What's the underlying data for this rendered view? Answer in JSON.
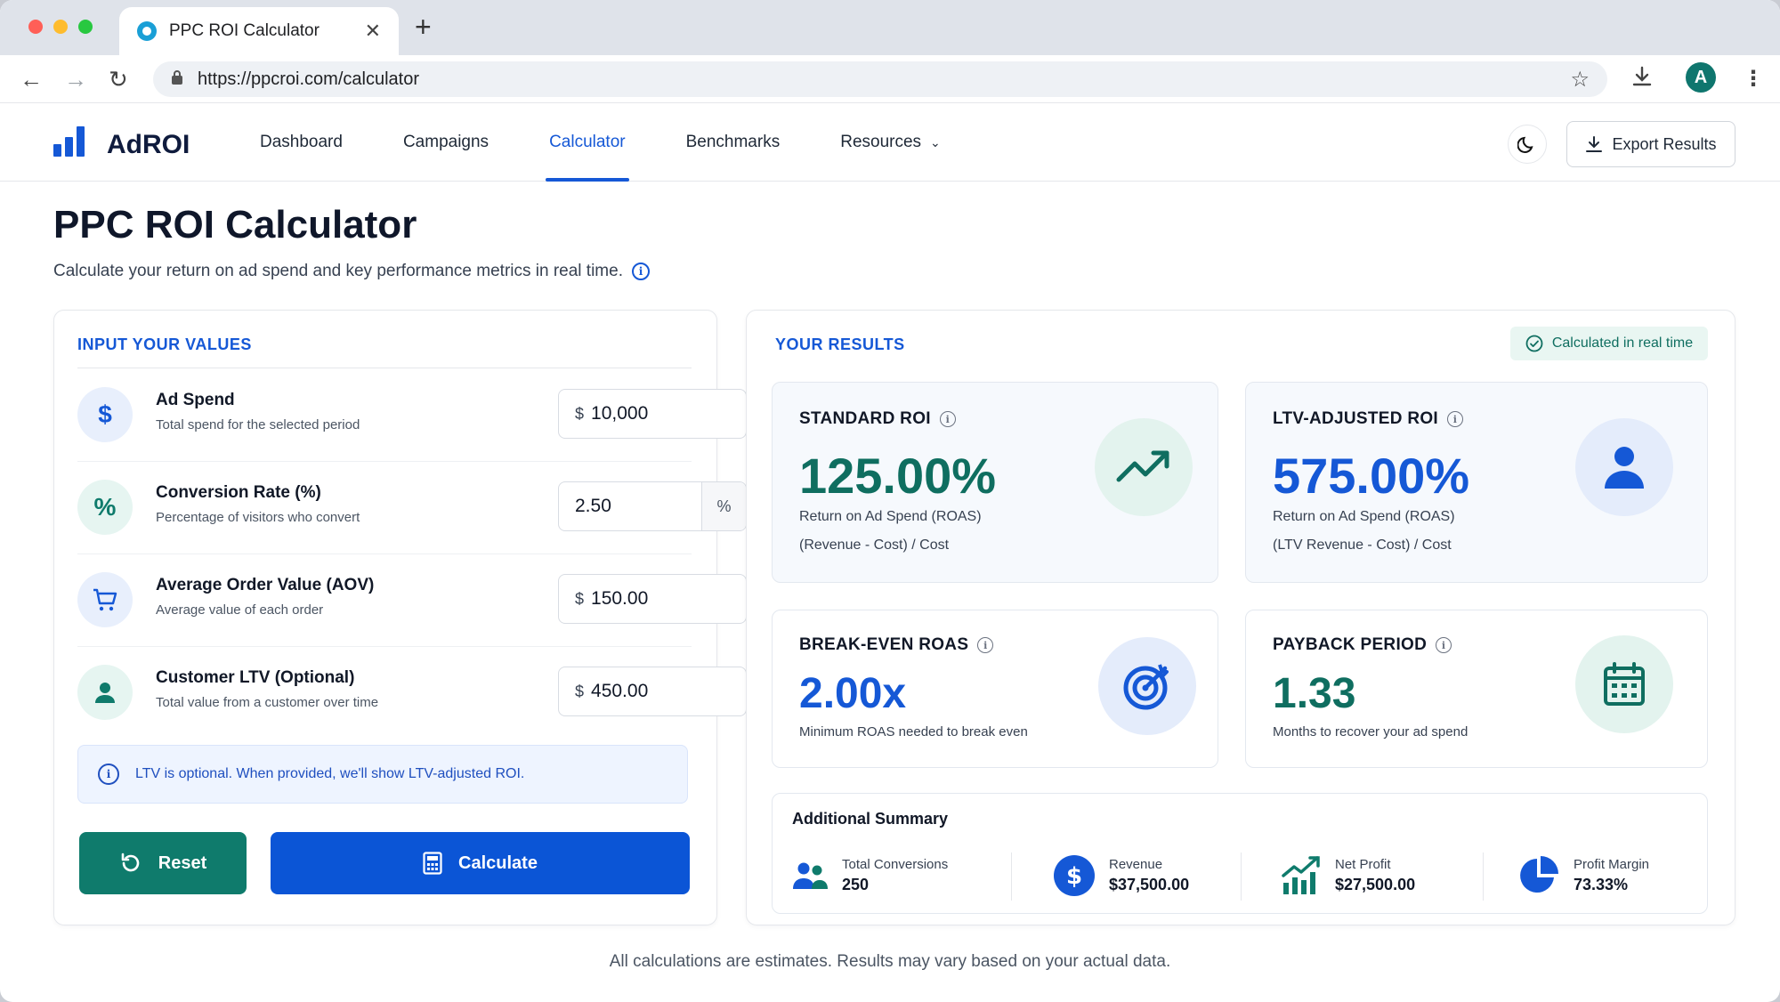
{
  "browser": {
    "tab_title": "PPC ROI Calculator",
    "tab_close": "✕",
    "new_tab": "+",
    "url": "https://ppcroi.com/calculator",
    "profile_initial": "A"
  },
  "header": {
    "logo_text": "AdROI",
    "nav": [
      "Dashboard",
      "Campaigns",
      "Calculator",
      "Benchmarks",
      "Resources"
    ],
    "active_nav": "Calculator",
    "export_label": "Export Results"
  },
  "page": {
    "title": "PPC ROI Calculator",
    "subtitle": "Calculate your return on ad spend and key performance metrics in real time."
  },
  "inputs": {
    "section_title": "INPUT YOUR VALUES",
    "ad_spend": {
      "label": "Ad Spend",
      "hint": "Total spend for the selected period",
      "currency": "$",
      "value": "10,000"
    },
    "conversion_rate": {
      "label": "Conversion Rate (%)",
      "hint": "Percentage of visitors who convert",
      "value": "2.50",
      "suffix": "%"
    },
    "aov": {
      "label": "Average Order Value (AOV)",
      "hint": "Average value of each order",
      "currency": "$",
      "value": "150.00"
    },
    "ltv": {
      "label": "Customer LTV (Optional)",
      "hint": "Total value from a customer over time",
      "currency": "$",
      "value": "450.00"
    },
    "notice": "LTV is optional. When provided, we'll show LTV-adjusted ROI.",
    "reset_label": "Reset",
    "calculate_label": "Calculate"
  },
  "results": {
    "section_title": "YOUR RESULTS",
    "realtime_badge": "Calculated in real time",
    "standard_roi": {
      "title": "STANDARD ROI",
      "value": "125.00%",
      "line1": "Return on Ad Spend (ROAS)",
      "line2": "(Revenue - Cost) / Cost"
    },
    "ltv_roi": {
      "title": "LTV-ADJUSTED ROI",
      "value": "575.00%",
      "line1": "Return on Ad Spend (ROAS)",
      "line2": "(LTV Revenue - Cost) / Cost"
    },
    "break_even": {
      "title": "BREAK-EVEN ROAS",
      "value": "2.00x",
      "line1": "Minimum ROAS needed to break even"
    },
    "payback": {
      "title": "PAYBACK PERIOD",
      "value": "1.33",
      "line1": "Months to recover your ad spend"
    },
    "summary": {
      "title": "Additional Summary",
      "total_conversions": {
        "label": "Total Conversions",
        "value": "250"
      },
      "revenue": {
        "label": "Revenue",
        "value": "$37,500.00"
      },
      "net_profit": {
        "label": "Net Profit",
        "value": "$27,500.00"
      },
      "profit_margin": {
        "label": "Profit Margin",
        "value": "73.33%"
      }
    }
  },
  "footer_note": "All calculations are estimates. Results may vary based on your actual data.",
  "colors": {
    "primary": "#1558d6",
    "teal": "#0f7b6c",
    "text": "#0f172a"
  }
}
